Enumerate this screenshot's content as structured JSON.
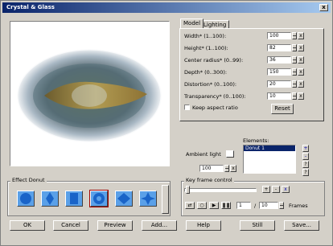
{
  "window": {
    "title": "Crystal & Glass",
    "close_label": "x"
  },
  "tabs": [
    {
      "label": "Model"
    },
    {
      "label": "Lighting"
    }
  ],
  "params": [
    {
      "label": "Width* (1..100):",
      "value": "100"
    },
    {
      "label": "Height* (1..100):",
      "value": "82"
    },
    {
      "label": "Center radius* (0..99):",
      "value": "36"
    },
    {
      "label": "Depth* (0..300):",
      "value": "150"
    },
    {
      "label": "Distortion* (0..100):",
      "value": "20"
    },
    {
      "label": "Transparency* (0..100):",
      "value": "10"
    }
  ],
  "keep_aspect": {
    "label": "Keep aspect ratio",
    "checked": false
  },
  "reset_label": "Reset",
  "elements": {
    "label": "Elements:",
    "items": [
      "Donut 1"
    ]
  },
  "ambient": {
    "label": "Ambient light",
    "value": "100"
  },
  "effect": {
    "label": "Effect Donut"
  },
  "keyframe": {
    "label": "Key frame control",
    "current": "1",
    "separator": "/",
    "total": "10",
    "frames_label": "Frames"
  },
  "buttons": {
    "ok": "OK",
    "cancel": "Cancel",
    "preview": "Preview",
    "add": "Add...",
    "help": "Help",
    "still": "Still",
    "save": "Save..."
  },
  "colors": {
    "title_start": "#0a246a",
    "title_end": "#a6caf0",
    "shape_blue": "#5aa0e8"
  }
}
